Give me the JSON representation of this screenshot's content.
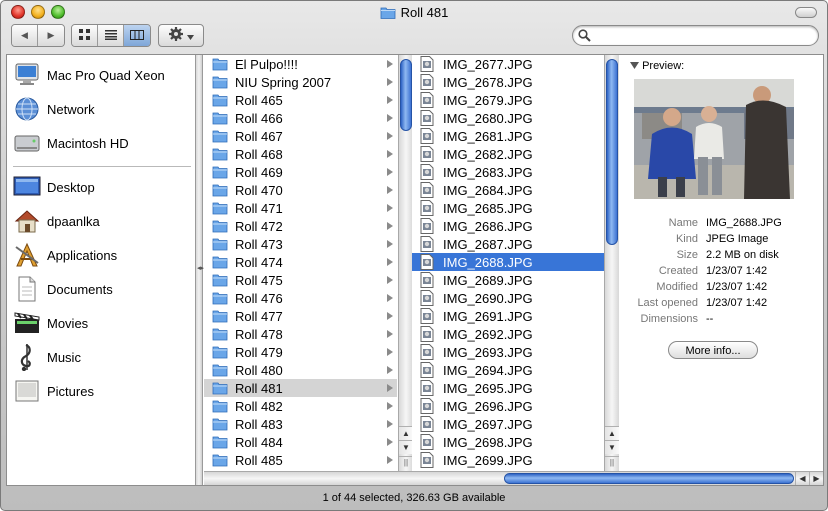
{
  "window": {
    "title": "Roll 481"
  },
  "toolbar": {
    "back_glyph": "◀",
    "forward_glyph": "▶",
    "view_icons": [
      "icon-view-icon",
      "list-view-icon",
      "column-view-icon"
    ],
    "action_icon": "gear-icon",
    "search_value": ""
  },
  "sidebar": {
    "items": [
      {
        "label": "Mac Pro Quad Xeon",
        "icon": "computer-icon"
      },
      {
        "label": "Network",
        "icon": "network-icon"
      },
      {
        "label": "Macintosh HD",
        "icon": "hard-drive-icon"
      },
      {
        "label": "Desktop",
        "icon": "desktop-icon"
      },
      {
        "label": "dpaanlka",
        "icon": "home-icon"
      },
      {
        "label": "Applications",
        "icon": "applications-icon"
      },
      {
        "label": "Documents",
        "icon": "documents-icon"
      },
      {
        "label": "Movies",
        "icon": "movies-icon"
      },
      {
        "label": "Music",
        "icon": "music-icon"
      },
      {
        "label": "Pictures",
        "icon": "pictures-icon"
      }
    ]
  },
  "column1": {
    "items": [
      "El Pulpo!!!!",
      "NIU Spring 2007",
      "Roll 465",
      "Roll 466",
      "Roll 467",
      "Roll 468",
      "Roll 469",
      "Roll 470",
      "Roll 471",
      "Roll 472",
      "Roll 473",
      "Roll 474",
      "Roll 475",
      "Roll 476",
      "Roll 477",
      "Roll 478",
      "Roll 479",
      "Roll 480",
      "Roll 481",
      "Roll 482",
      "Roll 483",
      "Roll 484",
      "Roll 485"
    ],
    "selected": "Roll 481"
  },
  "column2": {
    "items": [
      "IMG_2677.JPG",
      "IMG_2678.JPG",
      "IMG_2679.JPG",
      "IMG_2680.JPG",
      "IMG_2681.JPG",
      "IMG_2682.JPG",
      "IMG_2683.JPG",
      "IMG_2684.JPG",
      "IMG_2685.JPG",
      "IMG_2686.JPG",
      "IMG_2687.JPG",
      "IMG_2688.JPG",
      "IMG_2689.JPG",
      "IMG_2690.JPG",
      "IMG_2691.JPG",
      "IMG_2692.JPG",
      "IMG_2693.JPG",
      "IMG_2694.JPG",
      "IMG_2695.JPG",
      "IMG_2696.JPG",
      "IMG_2697.JPG",
      "IMG_2698.JPG",
      "IMG_2699.JPG"
    ],
    "selected": "IMG_2688.JPG"
  },
  "preview": {
    "label": "Preview:",
    "info": [
      {
        "key": "Name",
        "value": "IMG_2688.JPG"
      },
      {
        "key": "Kind",
        "value": "JPEG Image"
      },
      {
        "key": "Size",
        "value": "2.2 MB on disk"
      },
      {
        "key": "Created",
        "value": "1/23/07 1:42"
      },
      {
        "key": "Modified",
        "value": "1/23/07 1:42"
      },
      {
        "key": "Last opened",
        "value": "1/23/07 1:42"
      },
      {
        "key": "Dimensions",
        "value": "--"
      }
    ],
    "more_info_label": "More info..."
  },
  "status": {
    "text": "1 of 44 selected, 326.63 GB available"
  },
  "colors": {
    "selection_blue": "#3875d7",
    "selection_gray": "#d4d4d4"
  }
}
